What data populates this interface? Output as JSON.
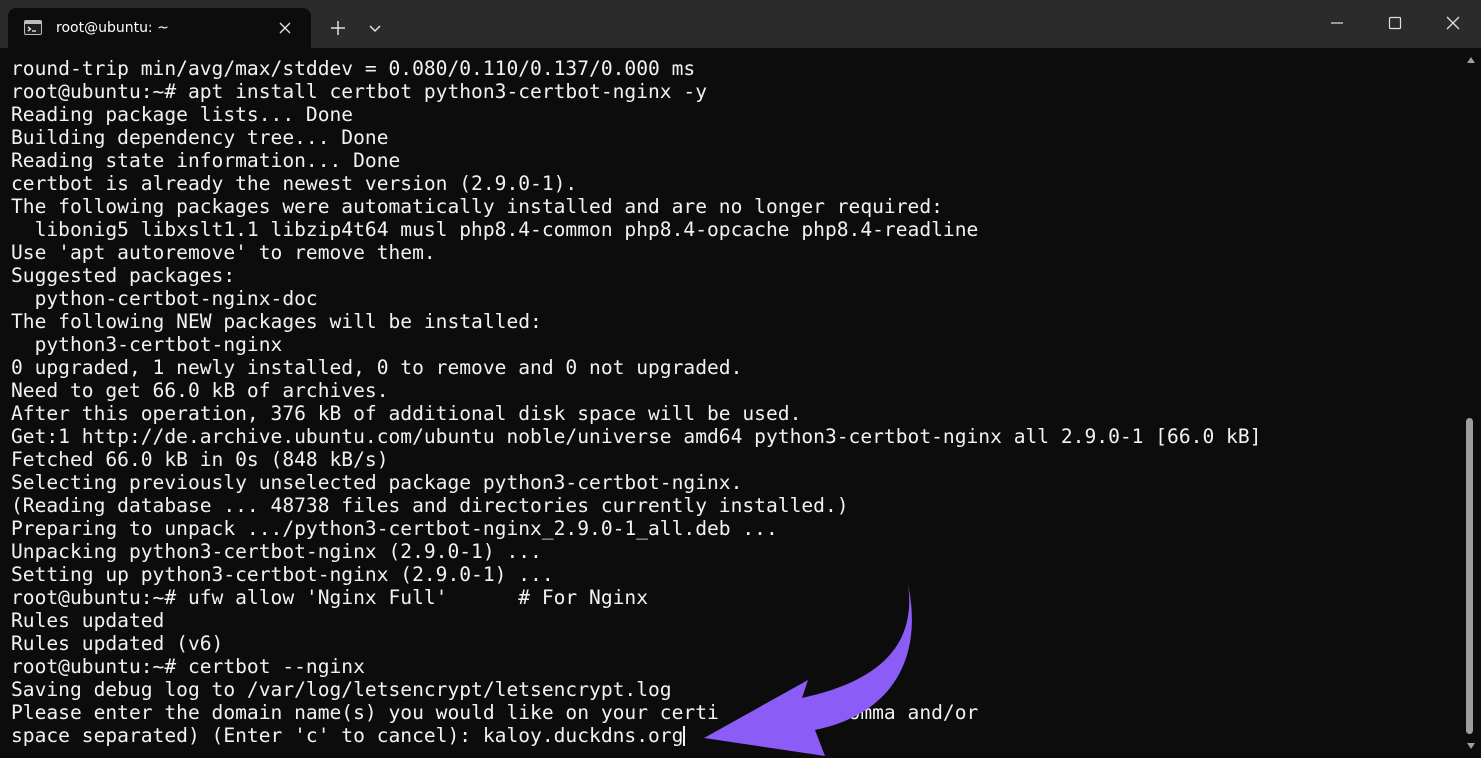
{
  "tab": {
    "title": "root@ubuntu: ~",
    "icon": "terminal-icon"
  },
  "titlebar_buttons": {
    "new_tab": "+",
    "minimize_icon": "minimize-icon",
    "maximize_icon": "maximize-icon",
    "close_icon": "close-icon"
  },
  "colors": {
    "background": "#0c0c0c",
    "titlebar": "#2b2b2b",
    "text": "#f2f2f2",
    "annotation_arrow": "#8b5cf6"
  },
  "terminal": {
    "lines": [
      "round-trip min/avg/max/stddev = 0.080/0.110/0.137/0.000 ms",
      "root@ubuntu:~# apt install certbot python3-certbot-nginx -y",
      "Reading package lists... Done",
      "Building dependency tree... Done",
      "Reading state information... Done",
      "certbot is already the newest version (2.9.0-1).",
      "The following packages were automatically installed and are no longer required:",
      "  libonig5 libxslt1.1 libzip4t64 musl php8.4-common php8.4-opcache php8.4-readline",
      "Use 'apt autoremove' to remove them.",
      "Suggested packages:",
      "  python-certbot-nginx-doc",
      "The following NEW packages will be installed:",
      "  python3-certbot-nginx",
      "0 upgraded, 1 newly installed, 0 to remove and 0 not upgraded.",
      "Need to get 66.0 kB of archives.",
      "After this operation, 376 kB of additional disk space will be used.",
      "Get:1 http://de.archive.ubuntu.com/ubuntu noble/universe amd64 python3-certbot-nginx all 2.9.0-1 [66.0 kB]",
      "Fetched 66.0 kB in 0s (848 kB/s)",
      "Selecting previously unselected package python3-certbot-nginx.",
      "(Reading database ... 48738 files and directories currently installed.)",
      "Preparing to unpack .../python3-certbot-nginx_2.9.0-1_all.deb ...",
      "Unpacking python3-certbot-nginx (2.9.0-1) ...",
      "Setting up python3-certbot-nginx (2.9.0-1) ...",
      "root@ubuntu:~# ufw allow 'Nginx Full'      # For Nginx",
      "Rules updated",
      "Rules updated (v6)",
      "root@ubuntu:~# certbot --nginx",
      "Saving debug log to /var/log/letsencrypt/letsencrypt.log",
      "Please enter the domain name(s) you would like on your certi          comma and/or",
      "space separated) (Enter 'c' to cancel): kaloy.duckdns.org"
    ]
  }
}
